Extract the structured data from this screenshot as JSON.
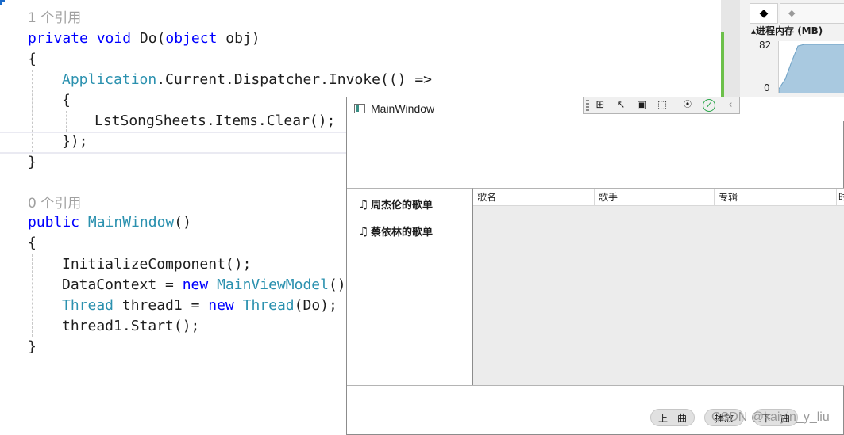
{
  "editor": {
    "lens_1": "1 个引用",
    "lens_2": "0 个引用",
    "l1_kw1": "private",
    "l1_kw2": "void",
    "l1_name": "Do(",
    "l1_kw3": "object",
    "l1_rest": "obj)",
    "brace_open": "{",
    "brace_close": "}",
    "l3_type": "Application",
    "l3_rest": ".Current.Dispatcher.Invoke(() =>",
    "l4": "{",
    "l5": "LstSongSheets.Items.Clear();",
    "l6": "});",
    "l9_kw": "public",
    "l9_type": "MainWindow",
    "l9_rest": "()",
    "l11": "InitializeComponent();",
    "l12_a": "DataContext = ",
    "l12_kw": "new",
    "l12_type": "MainViewModel",
    "l12_b": "();",
    "l13_type1": "Thread",
    "l13_a": " thread1 = ",
    "l13_kw": "new",
    "l13_type2": "Thread",
    "l13_b": "(Do);",
    "l14": "thread1.Start();"
  },
  "diagnostics": {
    "tab_icon": "◆",
    "tab_icon2": "◆",
    "memory_title": "▴进程内存 (MB)",
    "axis_max": "82",
    "axis_min": "0"
  },
  "window": {
    "title": "MainWindow",
    "debug_icons": [
      "select-element-icon",
      "pointer-icon",
      "layout-adorner-icon",
      "track-focus-icon",
      "binding-icon",
      "check-icon",
      "collapse-icon"
    ],
    "debug_glyphs": [
      "⊞",
      "↖",
      "▣",
      "⬚",
      "⦿",
      "✓",
      "‹"
    ],
    "song_sheets": [
      {
        "icon": "♫",
        "label": "周杰伦的歌单"
      },
      {
        "icon": "♫",
        "label": "蔡依林的歌单"
      }
    ],
    "columns": [
      "歌名",
      "歌手",
      "专辑",
      "时"
    ],
    "buttons": {
      "prev": "上一曲",
      "play": "播放",
      "next": "下一曲"
    }
  },
  "watermark": "CSDN @kaiyin_y_liu",
  "colors": {
    "keyword": "#0000ff",
    "type": "#2b91af",
    "memory_fill": "#a9c9e0",
    "cpu_bar": "#6cc04a",
    "check": "#2aa64a"
  }
}
